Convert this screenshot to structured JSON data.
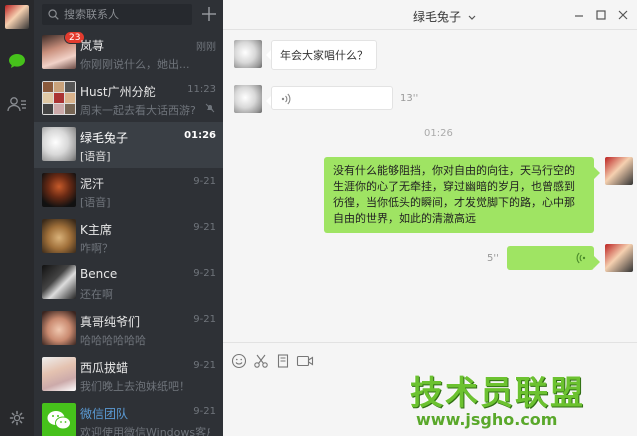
{
  "search": {
    "placeholder": "搜索联系人"
  },
  "conversations": [
    {
      "name": "岚荨",
      "preview": "你刚刚说什么，她出...",
      "time": "刚刚",
      "badge": "23",
      "avatar": "portrait-pink"
    },
    {
      "name": "Hust广州分舵",
      "preview": "周末一起去看大话西游?",
      "time": "11:23",
      "avatar": "group-grid"
    },
    {
      "name": "绿毛兔子",
      "preview": "[语音]",
      "time": "01:26",
      "avatar": "rabbit"
    },
    {
      "name": "泥汗",
      "preview": "[语音]",
      "time": "9-21",
      "avatar": "dark-portrait"
    },
    {
      "name": "K主席",
      "preview": "咋啊？",
      "time": "9-21",
      "avatar": "cat"
    },
    {
      "name": "Bence",
      "preview": "还在啊",
      "time": "9-21",
      "avatar": "bw-portrait"
    },
    {
      "name": "真哥纯爷们",
      "preview": "哈哈哈哈哈哈",
      "time": "9-21",
      "avatar": "face"
    },
    {
      "name": "西瓜拔蜡",
      "preview": "我们晚上去泡妹纸吧！",
      "time": "9-21",
      "avatar": "portrait-light"
    },
    {
      "name": "微信团队",
      "preview": "欢迎使用微信Windows客户端",
      "time": "9-21",
      "avatar": "wechat-logo"
    }
  ],
  "chat": {
    "title": "绿毛兔子",
    "messages": [
      {
        "from": "other",
        "text": "年会大家唱什么？"
      },
      {
        "from": "other",
        "type": "voice",
        "duration": "13''"
      },
      {
        "type": "time",
        "text": "01:26"
      },
      {
        "from": "me",
        "text": "没有什么能够阻挡，你对自由的向往，天马行空的生涯你的心了无牵挂，穿过幽暗的岁月，也曾感到彷徨，当你低头的瞬间，才发觉脚下的路，心中那自由的世界，如此的清澈高远"
      },
      {
        "from": "me",
        "type": "voice",
        "duration": "5''"
      }
    ]
  },
  "watermark": {
    "text": "技术员联盟",
    "url": "www.jsgho.com"
  },
  "colors": {
    "rail": "#28292c",
    "list": "#2e3136",
    "active": "#3a3f45",
    "bubble_out": "#9fe463",
    "badge": "#e33b2e"
  }
}
